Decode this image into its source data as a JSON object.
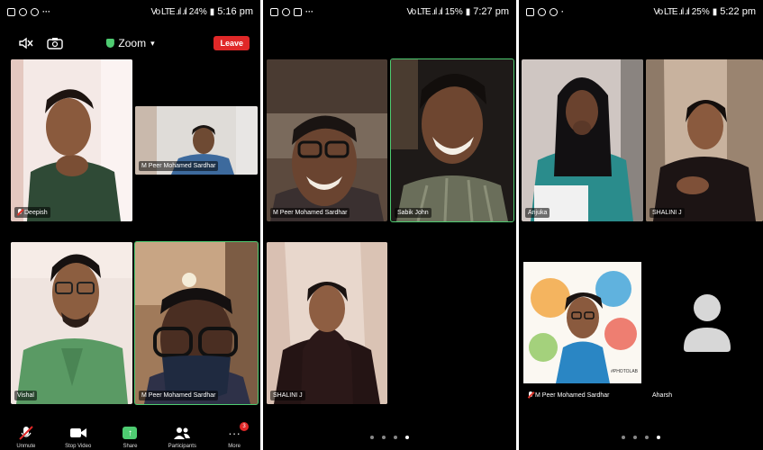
{
  "panels": [
    {
      "status": {
        "signal": "Vo LTE .ıl .ıl",
        "battery": "24%",
        "time": "5:16 pm"
      },
      "header": {
        "title": "Zoom",
        "leave_label": "Leave",
        "speaker_icon": "speaker-off-icon",
        "camera_icon": "camera-switch-icon"
      },
      "tiles": [
        {
          "name": "Deepish",
          "muted": true
        },
        {
          "name": "M Peer Mohamed Sardhar",
          "muted": false
        },
        {
          "name": "Vishal",
          "muted": false
        },
        {
          "name": "M Peer Mohamed Sardhar",
          "muted": false
        }
      ],
      "toolbar": [
        {
          "label": "Unmute",
          "icon": "mic-off-icon"
        },
        {
          "label": "Stop Video",
          "icon": "video-camera-icon"
        },
        {
          "label": "Share",
          "icon": "share-icon"
        },
        {
          "label": "Participants",
          "icon": "participants-icon"
        },
        {
          "label": "More",
          "icon": "more-icon",
          "badge": "3"
        }
      ]
    },
    {
      "status": {
        "signal": "Vo LTE .ıl .ıl",
        "battery": "15%",
        "time": "7:27 pm"
      },
      "tiles": [
        {
          "name": "M Peer Mohamed Sardhar"
        },
        {
          "name": "Sabik John"
        },
        {
          "name": "SHALINI J"
        }
      ],
      "page_dots": 4,
      "active_dot": 4
    },
    {
      "status": {
        "signal": "Vo LTE .ıl .ıl",
        "battery": "25%",
        "time": "5:22 pm"
      },
      "tiles": [
        {
          "name": "Anjuka"
        },
        {
          "name": "SHALINI J"
        },
        {
          "name": "M Peer Mohamed Sardhar",
          "muted": true,
          "watermark": "#PHOTOLAB"
        },
        {
          "name": "Aharsh"
        }
      ],
      "page_dots": 4,
      "active_dot": 4
    }
  ],
  "colors": {
    "accent_green": "#4ecb71",
    "leave_red": "#e02828",
    "background": "#000000"
  }
}
